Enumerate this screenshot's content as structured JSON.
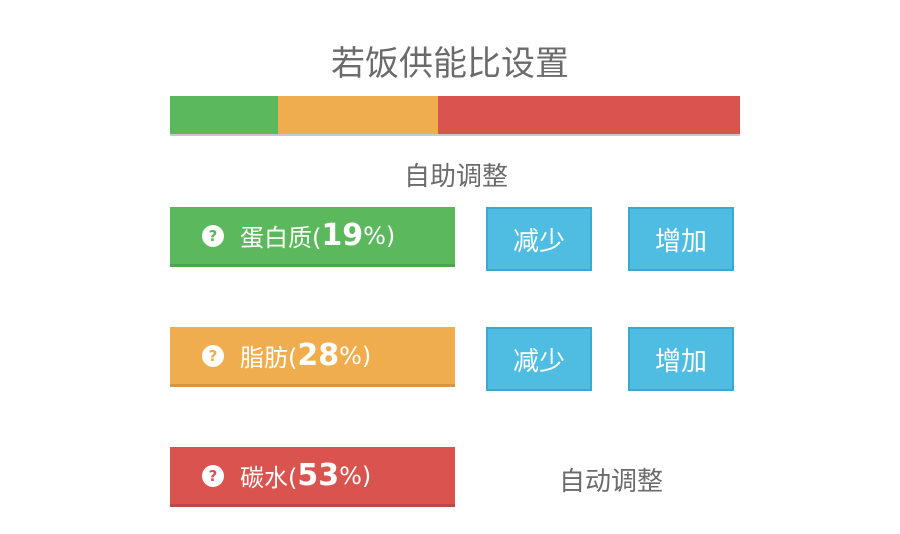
{
  "title": "若饭供能比设置",
  "ratio_bar": {
    "segments": [
      {
        "name": "protein",
        "percent": 19,
        "color": "#5cb85c"
      },
      {
        "name": "fat",
        "percent": 28,
        "color": "#f0ad4e"
      },
      {
        "name": "carbs",
        "percent": 53,
        "color": "#d9534f"
      }
    ]
  },
  "subtitle": "自助调整",
  "rows": {
    "protein": {
      "label": "蛋白质(",
      "percent": "19",
      "pct_suffix": "%)",
      "decrease": "减少",
      "increase": "增加",
      "color": "#5cb85c",
      "help": "?"
    },
    "fat": {
      "label": "脂肪(",
      "percent": "28",
      "pct_suffix": "%)",
      "decrease": "减少",
      "increase": "增加",
      "color": "#f0ad4e",
      "help": "?"
    },
    "carbs": {
      "label": "碳水(",
      "percent": "53",
      "pct_suffix": "%)",
      "auto_label": "自动调整",
      "color": "#d9534f",
      "help": "?"
    }
  }
}
